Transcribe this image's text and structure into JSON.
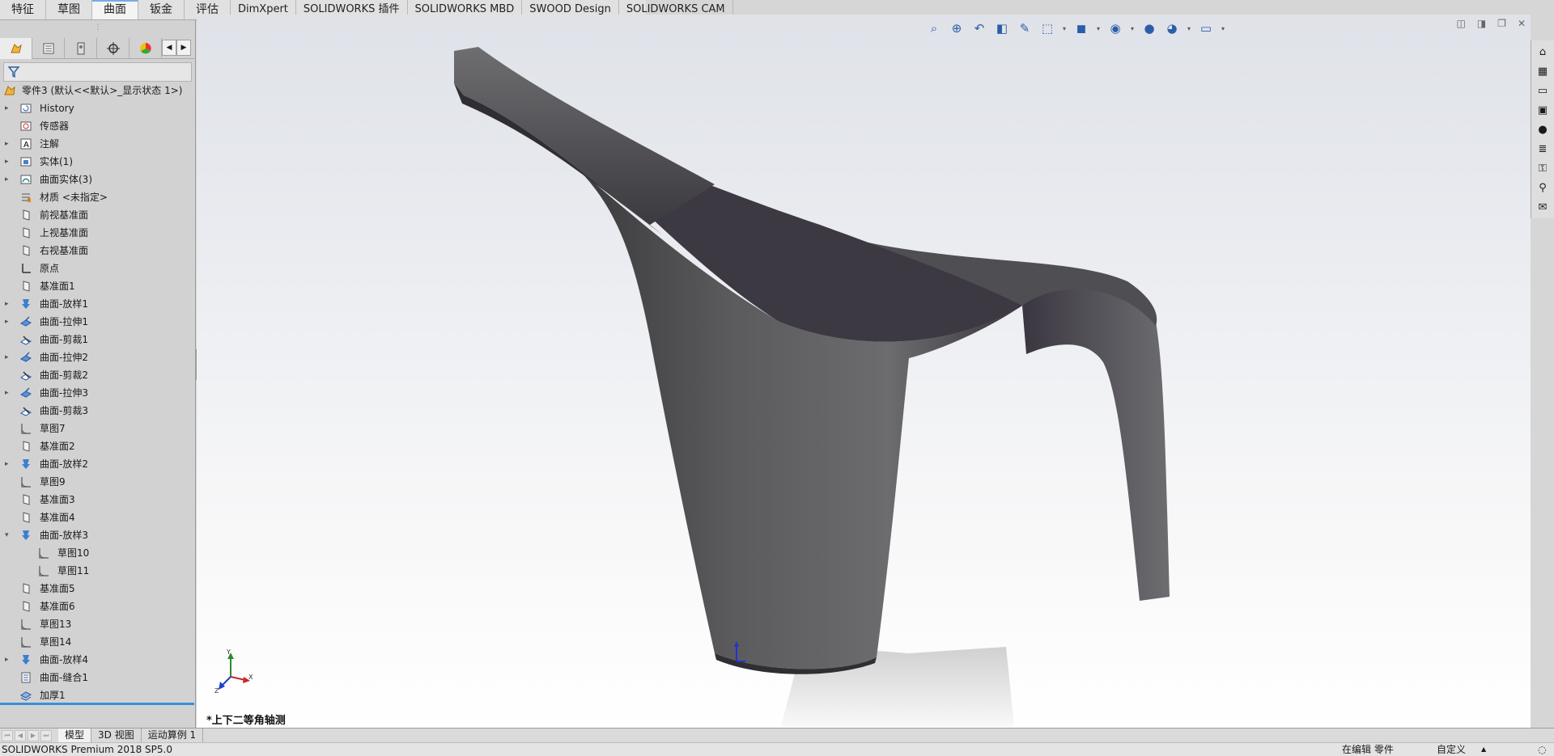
{
  "command_tabs": [
    "特征",
    "草图",
    "曲面",
    "钣金",
    "评估",
    "DimXpert",
    "SOLIDWORKS 插件",
    "SOLIDWORKS MBD",
    "SWOOD Design",
    "SOLIDWORKS CAM"
  ],
  "active_command_tab": "曲面",
  "tree": {
    "root": "零件3  (默认<<默认>_显示状态 1>)",
    "items": [
      {
        "label": "History",
        "icon": "history-icon",
        "expandable": true
      },
      {
        "label": "传感器",
        "icon": "sensor-icon",
        "expandable": false
      },
      {
        "label": "注解",
        "icon": "annotation-icon",
        "expandable": true
      },
      {
        "label": "实体(1)",
        "icon": "solid-bodies-icon",
        "expandable": true
      },
      {
        "label": "曲面实体(3)",
        "icon": "surface-bodies-icon",
        "expandable": true
      },
      {
        "label": "材质 <未指定>",
        "icon": "material-icon",
        "expandable": false
      },
      {
        "label": "前视基准面",
        "icon": "plane-icon",
        "expandable": false
      },
      {
        "label": "上视基准面",
        "icon": "plane-icon",
        "expandable": false
      },
      {
        "label": "右视基准面",
        "icon": "plane-icon",
        "expandable": false
      },
      {
        "label": "原点",
        "icon": "origin-icon",
        "expandable": false
      },
      {
        "label": "基准面1",
        "icon": "plane-icon",
        "expandable": false
      },
      {
        "label": "曲面-放样1",
        "icon": "loft-icon",
        "expandable": true
      },
      {
        "label": "曲面-拉伸1",
        "icon": "extrude-icon",
        "expandable": true
      },
      {
        "label": "曲面-剪裁1",
        "icon": "trim-icon",
        "expandable": false
      },
      {
        "label": "曲面-拉伸2",
        "icon": "extrude-icon",
        "expandable": true
      },
      {
        "label": "曲面-剪裁2",
        "icon": "trim-icon",
        "expandable": false
      },
      {
        "label": "曲面-拉伸3",
        "icon": "extrude-icon",
        "expandable": true
      },
      {
        "label": "曲面-剪裁3",
        "icon": "trim-icon",
        "expandable": false
      },
      {
        "label": "草图7",
        "icon": "sketch-icon",
        "expandable": false
      },
      {
        "label": "基准面2",
        "icon": "plane-icon",
        "expandable": false
      },
      {
        "label": "曲面-放样2",
        "icon": "loft-icon",
        "expandable": true
      },
      {
        "label": "草图9",
        "icon": "sketch-icon",
        "expandable": false
      },
      {
        "label": "基准面3",
        "icon": "plane-icon",
        "expandable": false
      },
      {
        "label": "基准面4",
        "icon": "plane-icon",
        "expandable": false
      },
      {
        "label": "曲面-放样3",
        "icon": "loft-icon",
        "expandable": true,
        "expanded": true
      },
      {
        "label": "草图10",
        "icon": "sketch-icon",
        "expandable": false,
        "child": true
      },
      {
        "label": "草图11",
        "icon": "sketch-icon",
        "expandable": false,
        "child": true
      },
      {
        "label": "基准面5",
        "icon": "plane-icon",
        "expandable": false
      },
      {
        "label": "基准面6",
        "icon": "plane-icon",
        "expandable": false
      },
      {
        "label": "草图13",
        "icon": "sketch-icon",
        "expandable": false
      },
      {
        "label": "草图14",
        "icon": "sketch-icon",
        "expandable": false
      },
      {
        "label": "曲面-放样4",
        "icon": "loft-icon",
        "expandable": true
      },
      {
        "label": "曲面-缝合1",
        "icon": "knit-icon",
        "expandable": false
      },
      {
        "label": "加厚1",
        "icon": "thicken-icon",
        "expandable": false
      }
    ]
  },
  "viewport": {
    "view_name": "*上下二等角轴测",
    "triad_labels": {
      "x": "X",
      "y": "Y",
      "z": "Z"
    }
  },
  "bottom_tabs": [
    "模型",
    "3D 视图",
    "运动算例 1"
  ],
  "active_bottom_tab": "模型",
  "status": {
    "product": "SOLIDWORKS Premium 2018 SP5.0",
    "editing": "在编辑 零件",
    "units": "自定义",
    "caret": "▲"
  },
  "colors": {
    "selection_accent": "#3a8fd6",
    "model_gray": "#5a5a5c"
  }
}
